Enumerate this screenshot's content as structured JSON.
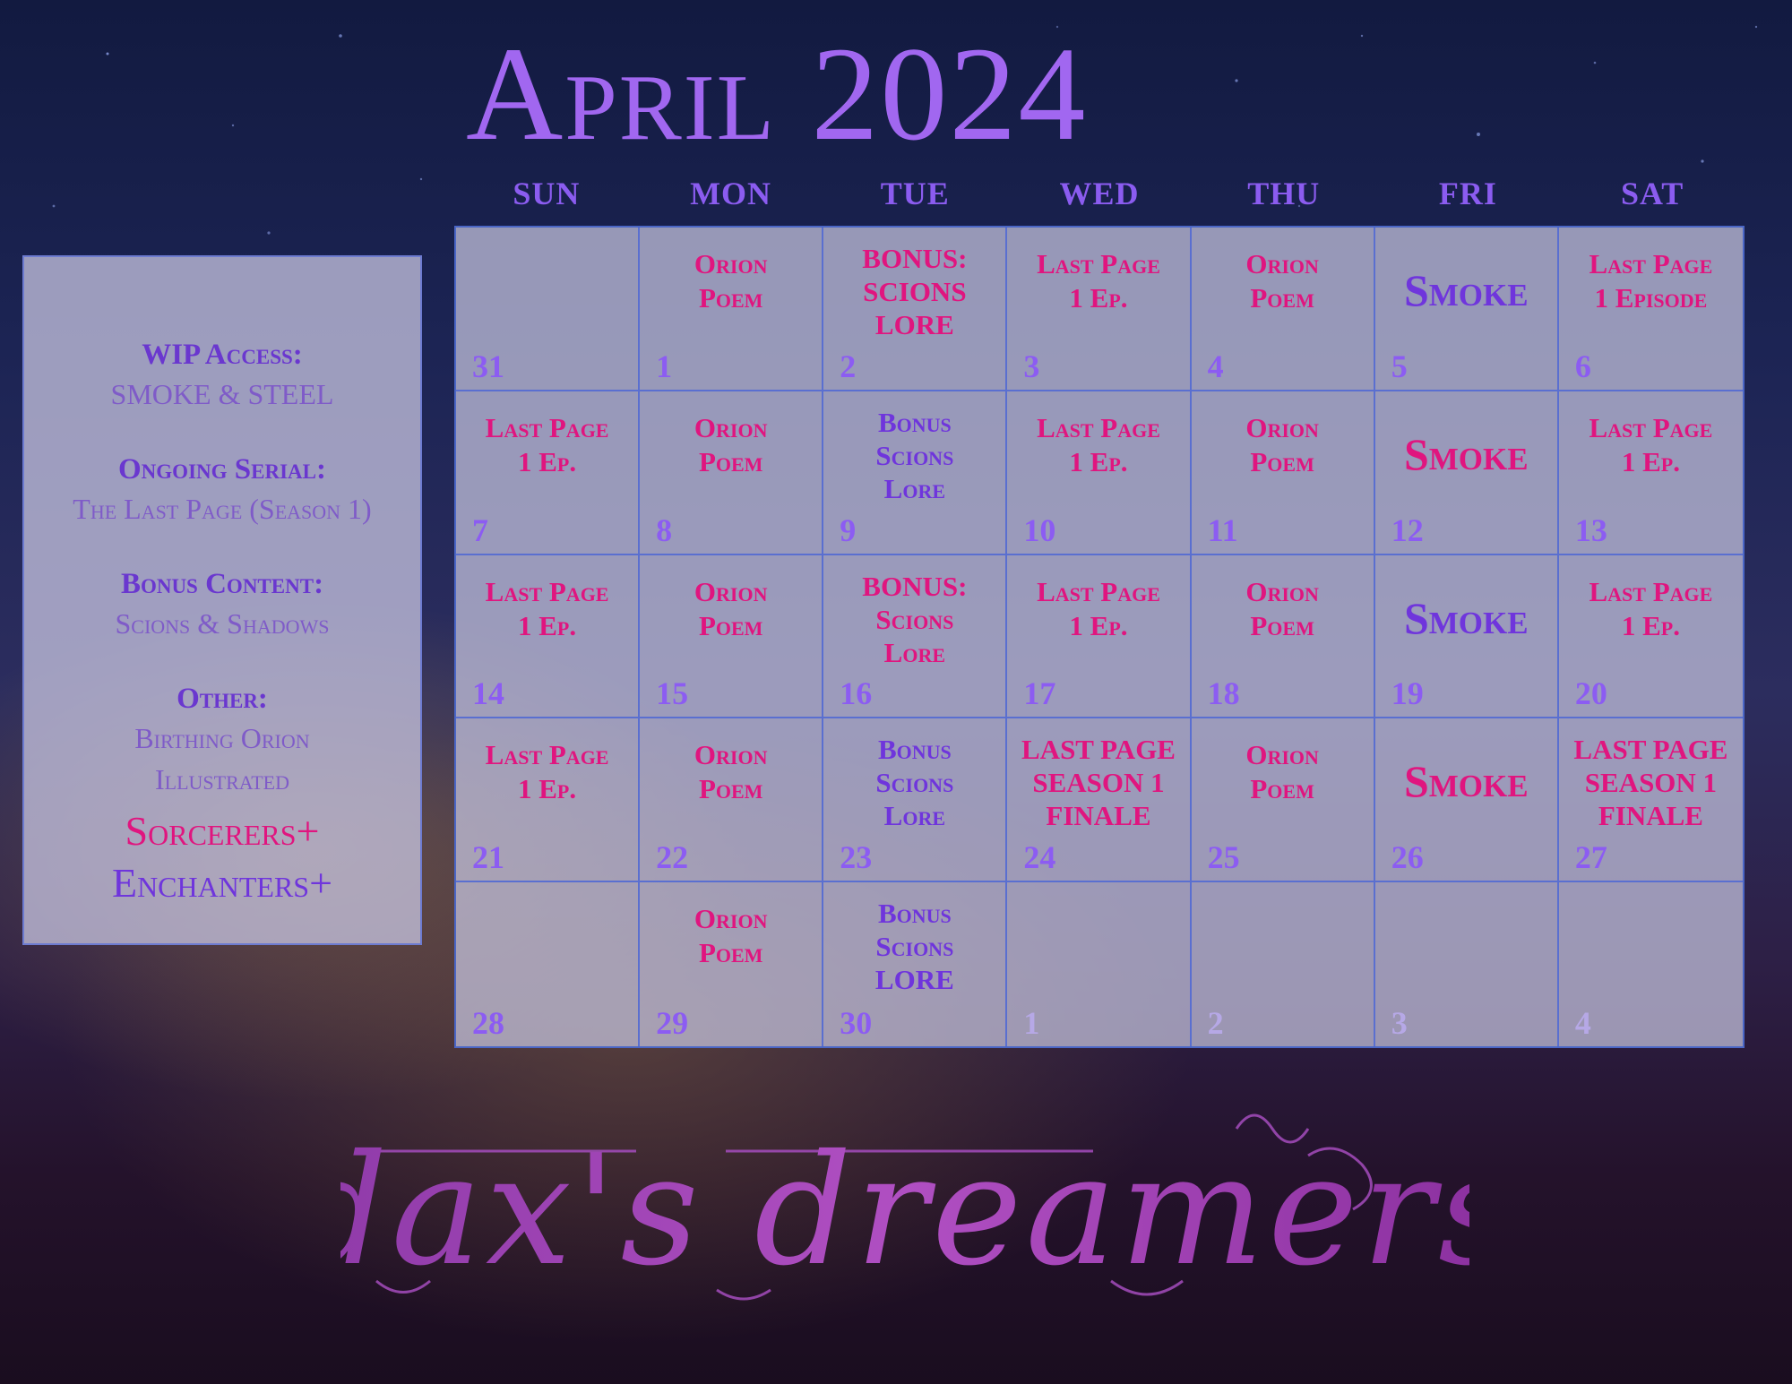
{
  "title": "April 2024",
  "weekdays": [
    "SUN",
    "MON",
    "TUE",
    "WED",
    "THU",
    "FRI",
    "SAT"
  ],
  "info_panel": {
    "wip_heading": "WIP Access:",
    "wip_value": "SMOKE & STEEL",
    "serial_heading": "Ongoing Serial:",
    "serial_value": "The Last Page (Season 1)",
    "bonus_heading": "Bonus Content:",
    "bonus_value": "Scions & Shadows",
    "other_heading": "Other:",
    "other_value_line1": "Birthing Orion",
    "other_value_line2": "Illustrated",
    "tier1": "Sorcerers+",
    "tier2": "Enchanters+"
  },
  "colors": {
    "accent_pink": "#e0157f",
    "accent_purple": "#6f35dc",
    "title_purple": "#a167f0"
  },
  "logo_text": "dax's dreamers",
  "calendar": [
    [
      {
        "day": "31",
        "lines": [],
        "faded": false
      },
      {
        "day": "1",
        "lines": [
          "Orion",
          "Poem"
        ],
        "color": "pink"
      },
      {
        "day": "2",
        "lines": [
          "BONUS:",
          "SCIONS",
          "LORE"
        ],
        "color": "pink"
      },
      {
        "day": "3",
        "lines": [
          "Last Page",
          "1 Ep."
        ],
        "color": "pink"
      },
      {
        "day": "4",
        "lines": [
          "Orion",
          "Poem"
        ],
        "color": "pink"
      },
      {
        "day": "5",
        "lines": [
          "Smoke"
        ],
        "color": "purple",
        "big": true
      },
      {
        "day": "6",
        "lines": [
          "Last Page",
          "1 Episode"
        ],
        "color": "pink"
      }
    ],
    [
      {
        "day": "7",
        "lines": [
          "Last Page",
          "1 Ep."
        ],
        "color": "pink"
      },
      {
        "day": "8",
        "lines": [
          "Orion",
          "Poem"
        ],
        "color": "pink"
      },
      {
        "day": "9",
        "lines": [
          "Bonus",
          "Scions",
          "Lore"
        ],
        "color": "purple"
      },
      {
        "day": "10",
        "lines": [
          "Last Page",
          "1 Ep."
        ],
        "color": "pink"
      },
      {
        "day": "11",
        "lines": [
          "Orion",
          "Poem"
        ],
        "color": "pink"
      },
      {
        "day": "12",
        "lines": [
          "Smoke"
        ],
        "color": "pink",
        "big": true
      },
      {
        "day": "13",
        "lines": [
          "Last Page",
          "1 Ep."
        ],
        "color": "pink"
      }
    ],
    [
      {
        "day": "14",
        "lines": [
          "Last Page",
          "1 Ep."
        ],
        "color": "pink"
      },
      {
        "day": "15",
        "lines": [
          "Orion",
          "Poem"
        ],
        "color": "pink"
      },
      {
        "day": "16",
        "lines": [
          "BONUS:",
          "Scions",
          "Lore"
        ],
        "color": "pink"
      },
      {
        "day": "17",
        "lines": [
          "Last Page",
          "1 Ep."
        ],
        "color": "pink"
      },
      {
        "day": "18",
        "lines": [
          "Orion",
          "Poem"
        ],
        "color": "pink"
      },
      {
        "day": "19",
        "lines": [
          "Smoke"
        ],
        "color": "purple",
        "big": true
      },
      {
        "day": "20",
        "lines": [
          "Last Page",
          "1 Ep."
        ],
        "color": "pink"
      }
    ],
    [
      {
        "day": "21",
        "lines": [
          "Last Page",
          "1 Ep."
        ],
        "color": "pink"
      },
      {
        "day": "22",
        "lines": [
          "Orion",
          "Poem"
        ],
        "color": "pink"
      },
      {
        "day": "23",
        "lines": [
          "Bonus",
          "Scions",
          "Lore"
        ],
        "color": "purple"
      },
      {
        "day": "24",
        "lines": [
          "LAST PAGE",
          "SEASON 1",
          "FINALE"
        ],
        "color": "pink"
      },
      {
        "day": "25",
        "lines": [
          "Orion",
          "Poem"
        ],
        "color": "pink"
      },
      {
        "day": "26",
        "lines": [
          "Smoke"
        ],
        "color": "pink",
        "big": true
      },
      {
        "day": "27",
        "lines": [
          "LAST PAGE",
          "SEASON 1",
          "FINALE"
        ],
        "color": "pink"
      }
    ],
    [
      {
        "day": "28",
        "lines": []
      },
      {
        "day": "29",
        "lines": [
          "Orion",
          "Poem"
        ],
        "color": "pink"
      },
      {
        "day": "30",
        "lines": [
          "Bonus",
          "Scions",
          "LORE"
        ],
        "color": "purple"
      },
      {
        "day": "1",
        "lines": [],
        "faded": true
      },
      {
        "day": "2",
        "lines": [],
        "faded": true
      },
      {
        "day": "3",
        "lines": [],
        "faded": true
      },
      {
        "day": "4",
        "lines": [],
        "faded": true
      }
    ]
  ]
}
